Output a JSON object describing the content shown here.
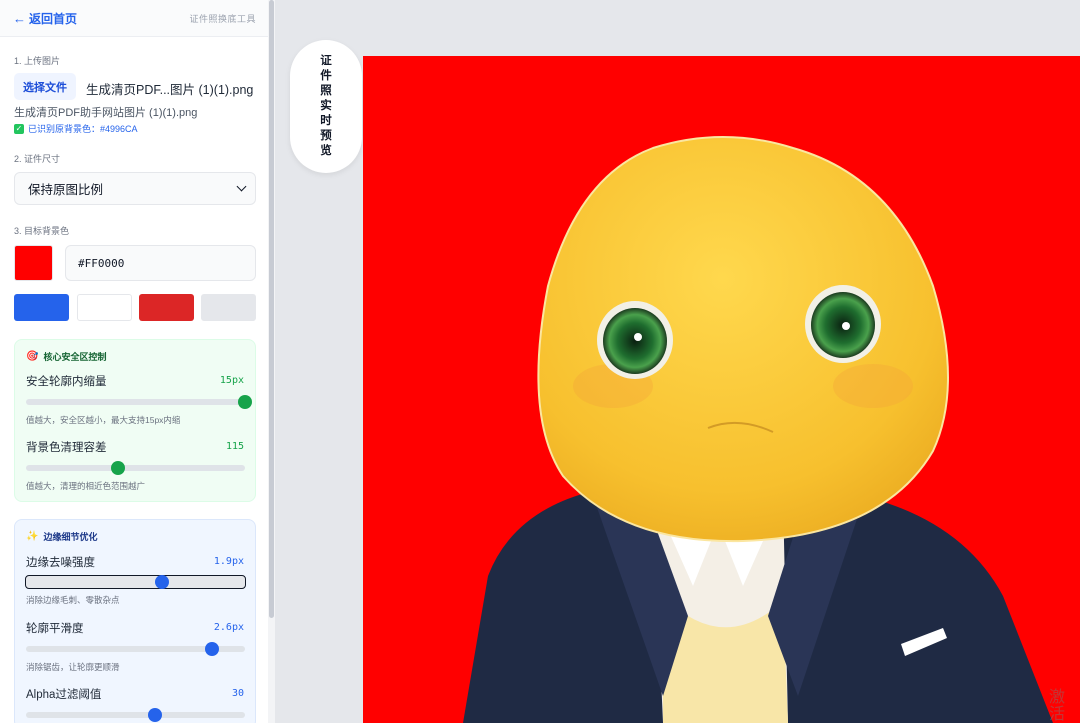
{
  "topbar": {
    "back_label": "返回首页",
    "tool_name": "证件照换底工具"
  },
  "upload": {
    "section_label": "1. 上传图片",
    "choose_button": "选择文件",
    "file_name_inline": "生成清页PDF...图片 (1)(1).png",
    "file_name_full": "生成清页PDF助手网站图片 (1)(1).png",
    "detected_text": "已识别原背景色：#4996CA"
  },
  "size": {
    "section_label": "2. 证件尺寸",
    "selected": "保持原图比例"
  },
  "background": {
    "section_label": "3. 目标背景色",
    "current_color": "#FF0000",
    "hex_value": "#FF0000",
    "presets": [
      "#2563EB",
      "#FFFFFF",
      "#DC2626",
      "#E5E7EB"
    ]
  },
  "safe_zone": {
    "title": "核心安全区控制",
    "rows": [
      {
        "label": "安全轮廓内缩量",
        "value": "15px",
        "level": 1.0,
        "help": "值越大，安全区越小，最大支持15px内缩"
      },
      {
        "label": "背景色清理容差",
        "value": "115",
        "level": 0.42,
        "help": "值越大，清理的相近色范围越广"
      }
    ]
  },
  "edge": {
    "title": "边缘细节优化",
    "rows": [
      {
        "label": "边缘去噪强度",
        "value": "1.9px",
        "level": 0.62,
        "help": "消除边缘毛刺、零散杂点"
      },
      {
        "label": "轮廓平滑度",
        "value": "2.6px",
        "level": 0.85,
        "help": "消除锯齿，让轮廓更顺滑"
      },
      {
        "label": "Alpha过滤阈值",
        "value": "30",
        "level": 0.59
      }
    ]
  },
  "preview": {
    "label_chars": [
      "证",
      "件",
      "照",
      "实",
      "时",
      "预",
      "览"
    ]
  },
  "watermark": {
    "line1": "激活",
    "line2": "转到"
  }
}
